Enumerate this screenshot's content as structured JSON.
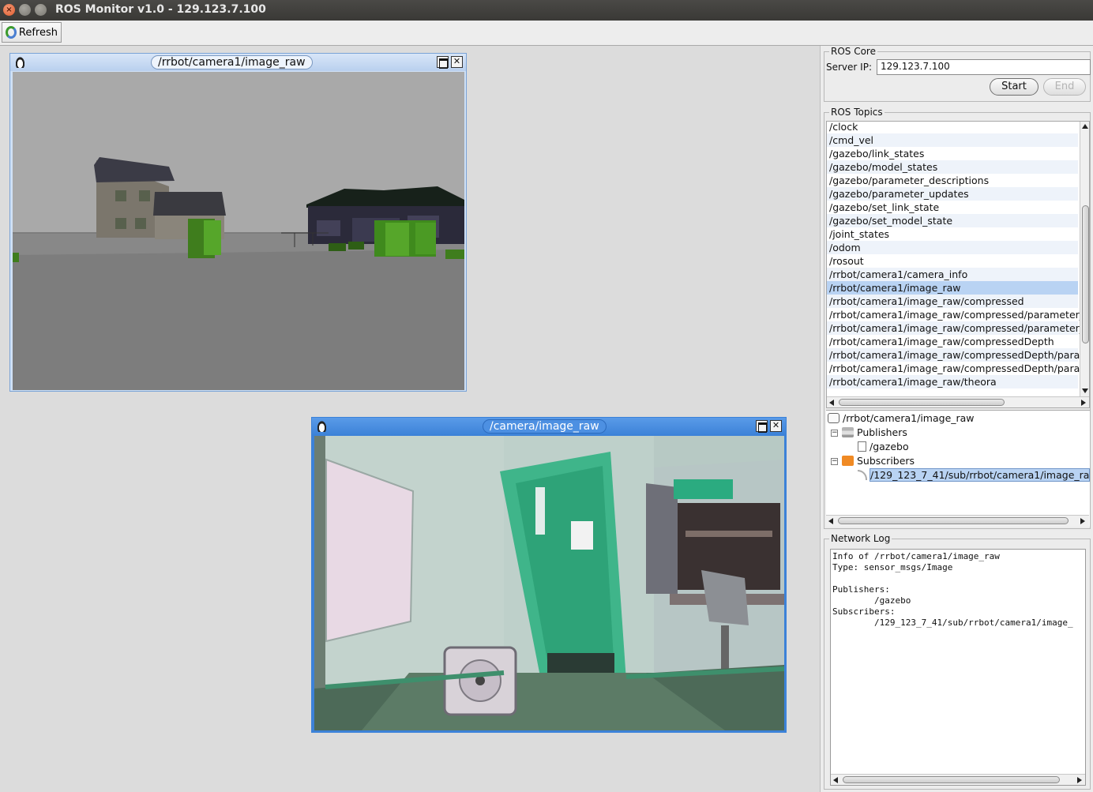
{
  "window": {
    "title": "ROS Monitor v1.0 - 129.123.7.100"
  },
  "toolbar": {
    "refresh_label": "Refresh"
  },
  "frames": [
    {
      "title": "/rrbot/camera1/image_raw",
      "active": false
    },
    {
      "title": "/camera/image_raw",
      "active": true
    }
  ],
  "ros_core": {
    "legend": "ROS Core",
    "server_ip_label": "Server IP:",
    "server_ip_value": "129.123.7.100",
    "start_label": "Start",
    "end_label": "End"
  },
  "ros_topics": {
    "legend": "ROS Topics",
    "items": [
      "/clock",
      "/cmd_vel",
      "/gazebo/link_states",
      "/gazebo/model_states",
      "/gazebo/parameter_descriptions",
      "/gazebo/parameter_updates",
      "/gazebo/set_link_state",
      "/gazebo/set_model_state",
      "/joint_states",
      "/odom",
      "/rosout",
      "/rrbot/camera1/camera_info",
      "/rrbot/camera1/image_raw",
      "/rrbot/camera1/image_raw/compressed",
      "/rrbot/camera1/image_raw/compressed/parameter_",
      "/rrbot/camera1/image_raw/compressed/parameter_",
      "/rrbot/camera1/image_raw/compressedDepth",
      "/rrbot/camera1/image_raw/compressedDepth/parar",
      "/rrbot/camera1/image_raw/compressedDepth/parar",
      "/rrbot/camera1/image_raw/theora"
    ],
    "selected_index": 12
  },
  "topic_tree": {
    "root": "/rrbot/camera1/image_raw",
    "publishers_label": "Publishers",
    "publisher": "/gazebo",
    "subscribers_label": "Subscribers",
    "subscriber": "/129_123_7_41/sub/rrbot/camera1/image_ra"
  },
  "network_log": {
    "legend": "Network Log",
    "lines": [
      "Info of /rrbot/camera1/image_raw",
      "Type: sensor_msgs/Image",
      "",
      "Publishers:",
      "        /gazebo",
      "Subscribers:",
      "        /129_123_7_41/sub/rrbot/camera1/image_"
    ]
  },
  "colors": {
    "active_frame": "#3c82d8",
    "selection": "#b9d3f3"
  }
}
